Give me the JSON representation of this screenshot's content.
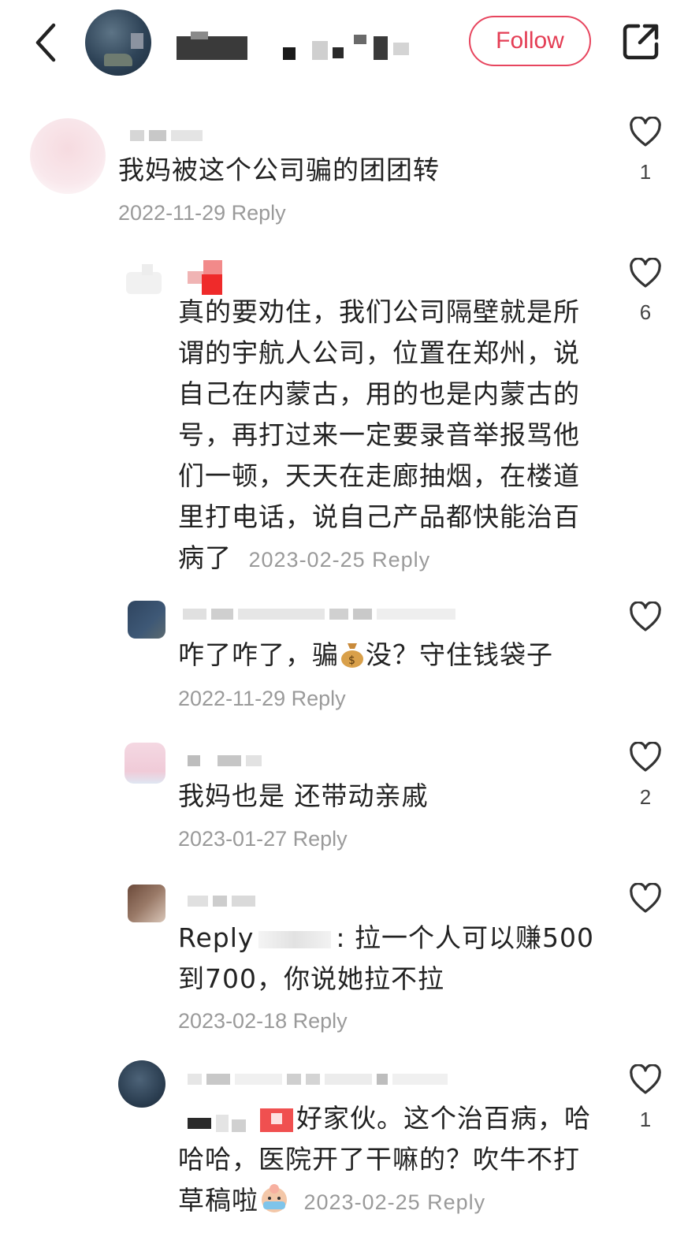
{
  "header": {
    "follow_label": "Follow",
    "icons": {
      "back": "chevron-left-icon",
      "share": "share-external-icon"
    }
  },
  "comments": [
    {
      "text": "我妈被这个公司骗的团团转",
      "date": "2022-11-29",
      "reply_label": "Reply",
      "likes": "1"
    },
    {
      "text_lines": [
        "真的要劝住，我们公司隔壁就是所",
        "谓的宇航人公司，位置在郑州，说",
        "自己在内蒙古，用的也是内蒙古的",
        "号，再打过来一定要录音举报骂他",
        "们一顿，天天在走廊抽烟，在楼道",
        "里打电话，说自己产品都快能治百",
        "病了"
      ],
      "date": "2023-02-25",
      "reply_label": "Reply",
      "likes": "6"
    },
    {
      "text_before": "咋了咋了，骗",
      "emoji": "money-bag-emoji",
      "text_after": "没？守住钱袋子",
      "date": "2022-11-29",
      "reply_label": "Reply"
    },
    {
      "text": "我妈也是 还带动亲戚",
      "date": "2023-01-27",
      "reply_label": "Reply",
      "likes": "2"
    },
    {
      "reply_prefix": "Reply",
      "text_line1": ": 拉一个人可以赚500",
      "text_line2": "到700，你说她拉不拉",
      "date": "2023-02-18",
      "reply_label": "Reply"
    },
    {
      "text_line1": "好家伙。这个治百病，哈",
      "text_line2": "哈哈，医院开了干嘛的？吹牛不打",
      "text_line3": "草稿啦",
      "emoji": "crying-emoji",
      "date": "2023-02-25",
      "reply_label": "Reply",
      "likes": "1"
    }
  ],
  "colors": {
    "accent": "#e43d54",
    "meta": "#9a9a9a",
    "text": "#222222"
  }
}
